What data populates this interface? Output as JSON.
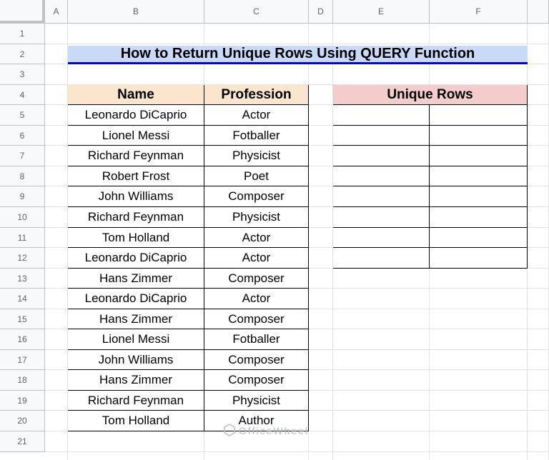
{
  "columns": [
    "A",
    "B",
    "C",
    "D",
    "E",
    "F"
  ],
  "rows": [
    "1",
    "2",
    "3",
    "4",
    "5",
    "6",
    "7",
    "8",
    "9",
    "10",
    "11",
    "12",
    "13",
    "14",
    "15",
    "16",
    "17",
    "18",
    "19",
    "20",
    "21"
  ],
  "title": "How to Return Unique Rows Using QUERY Function",
  "data_table": {
    "headers": [
      "Name",
      "Profession"
    ],
    "rows": [
      [
        "Leonardo DiCaprio",
        "Actor"
      ],
      [
        "Lionel Messi",
        "Fotballer"
      ],
      [
        "Richard Feynman",
        "Physicist"
      ],
      [
        "Robert Frost",
        "Poet"
      ],
      [
        "John Williams",
        "Composer"
      ],
      [
        "Richard Feynman",
        "Physicist"
      ],
      [
        "Tom Holland",
        "Actor"
      ],
      [
        "Leonardo DiCaprio",
        "Actor"
      ],
      [
        "Hans Zimmer",
        "Composer"
      ],
      [
        "Leonardo DiCaprio",
        "Actor"
      ],
      [
        "Hans Zimmer",
        "Composer"
      ],
      [
        "Lionel Messi",
        "Fotballer"
      ],
      [
        "John Williams",
        "Composer"
      ],
      [
        "Hans Zimmer",
        "Composer"
      ],
      [
        "Richard Feynman",
        "Physicist"
      ],
      [
        "Tom Holland",
        "Author"
      ]
    ]
  },
  "unique_table": {
    "header": "Unique Rows"
  },
  "watermark": "OfficeWheel",
  "colors": {
    "name_header_fill": "#fce5cd",
    "unique_header_fill": "#f4cccc",
    "title_fill": "#c9daf8",
    "title_underline": "#0000ff"
  }
}
